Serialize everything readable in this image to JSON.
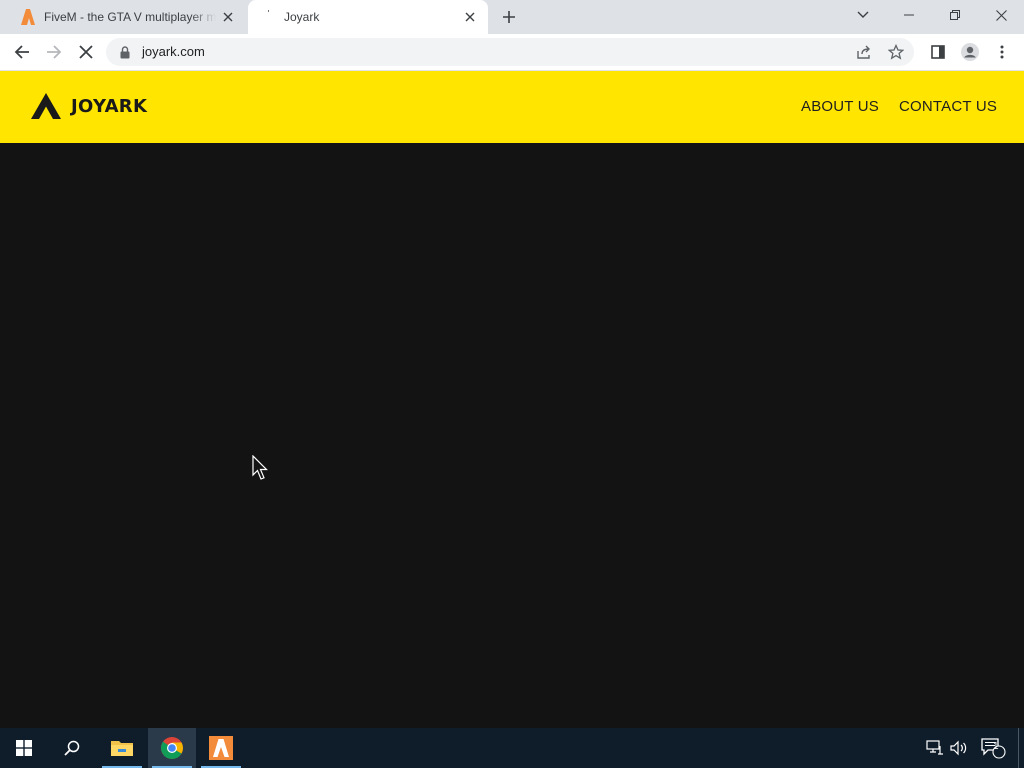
{
  "browser": {
    "tabs": [
      {
        "title": "FiveM - the GTA V multiplayer mod",
        "favicon": "fivem-icon",
        "active": false
      },
      {
        "title": "Joyark",
        "favicon": "loading-icon",
        "active": true
      }
    ],
    "address": "joyark.com"
  },
  "site": {
    "brand": "JOYARK",
    "nav": {
      "about": "ABOUT US",
      "contact": "CONTACT US"
    },
    "colors": {
      "header": "#ffe500",
      "body": "#141313"
    }
  },
  "taskbar": {
    "apps": [
      "file-explorer-icon",
      "chrome-icon",
      "fivem-icon"
    ],
    "active_app": "chrome-icon",
    "notification_count": "1"
  }
}
